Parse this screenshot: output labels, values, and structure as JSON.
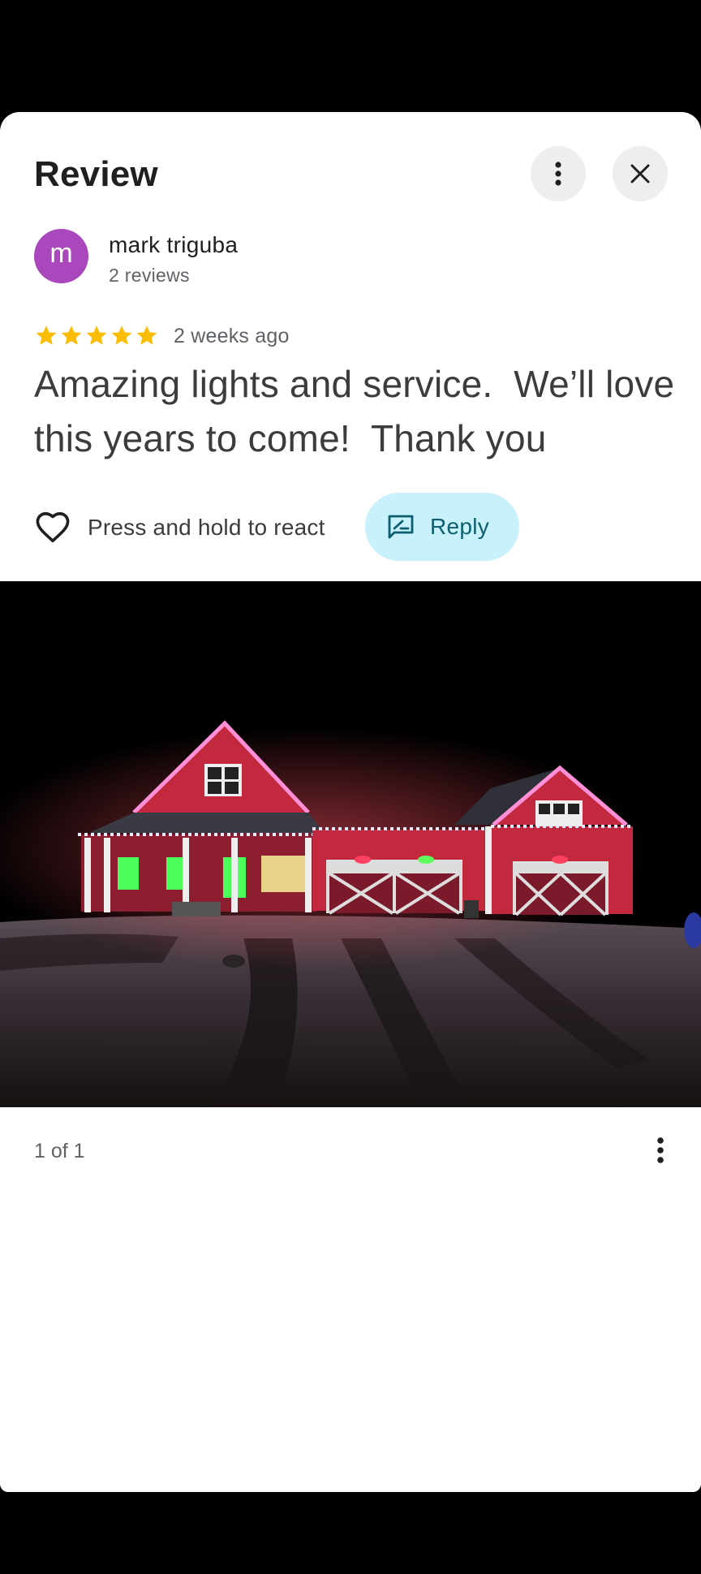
{
  "review": {
    "title": "Review",
    "author": {
      "initial": "m",
      "name": "mark triguba",
      "review_count": "2 reviews",
      "avatar_color": "#ab47bc"
    },
    "rating": {
      "stars": 5,
      "max_stars": 5,
      "time": "2 weeks ago",
      "star_color": "#fbbc04"
    },
    "text": "Amazing lights and service.  We’ll love this years to come!  Thank you",
    "actions": {
      "react_label": "Press and hold to react",
      "reply_label": "Reply"
    }
  },
  "photo": {
    "counter": "1 of 1"
  },
  "icons": {
    "more": "more-vert-icon",
    "close": "close-icon",
    "heart": "heart-outline-icon",
    "reply": "reply-edit-icon",
    "star": "star-icon"
  }
}
